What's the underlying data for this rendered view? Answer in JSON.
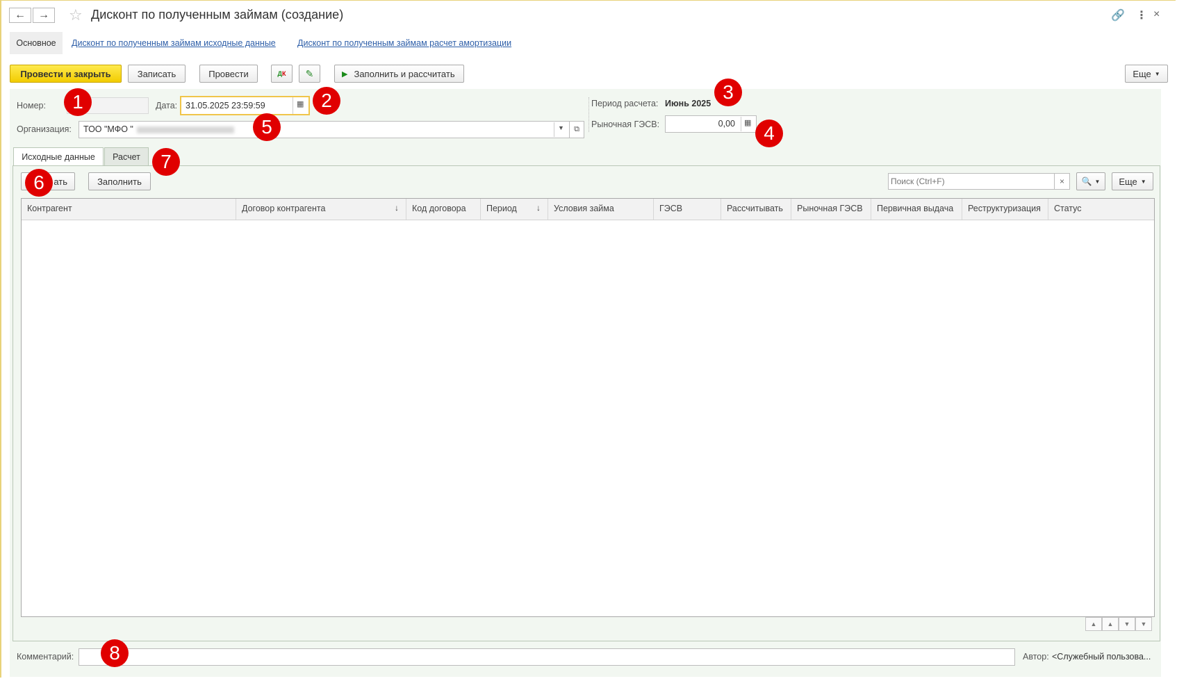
{
  "window": {
    "title": "Дисконт по полученным займам (создание)"
  },
  "panel": {
    "main_label": "Основное",
    "link_initial": "Дисконт по полученным займам исходные данные",
    "link_amort": "Дисконт по полученным займам расчет амортизации"
  },
  "toolbar": {
    "post_close": "Провести и закрыть",
    "save": "Записать",
    "post": "Провести",
    "fill_calc": "Заполнить и рассчитать",
    "more": "Еще"
  },
  "form": {
    "number_label": "Номер:",
    "number_value": "",
    "date_label": "Дата:",
    "date_value": "31.05.2025 23:59:59",
    "org_label": "Организация:",
    "org_value": "ТОО \"МФО \"",
    "period_label": "Период расчета:",
    "period_value": "Июнь 2025",
    "market_label": "Рыночная ГЭСВ:",
    "market_value": "0,00"
  },
  "tabs": [
    "Исходные данные",
    "Расчет"
  ],
  "table_toolbar": {
    "add": "ать",
    "fill": "Заполнить",
    "search_placeholder": "Поиск (Ctrl+F)",
    "more": "Еще"
  },
  "table": {
    "columns": [
      "Контрагент",
      "Договор контрагента",
      "Код договора",
      "Период",
      "Условия займа",
      "ГЭСВ",
      "Рассчитывать",
      "Рыночная ГЭСВ",
      "Первичная выдача",
      "Реструктуризация",
      "Статус"
    ],
    "rows": []
  },
  "footer": {
    "comment_label": "Комментарий:",
    "comment_value": "",
    "author_label": "Автор:",
    "author_value": "<Служебный пользова..."
  },
  "badges": [
    "1",
    "2",
    "3",
    "4",
    "5",
    "6",
    "7",
    "8"
  ],
  "colors": {
    "primary_button": "#f5d20a",
    "badge": "#e00000",
    "link": "#2d5ea8",
    "form_background": "#f2f7f1"
  }
}
